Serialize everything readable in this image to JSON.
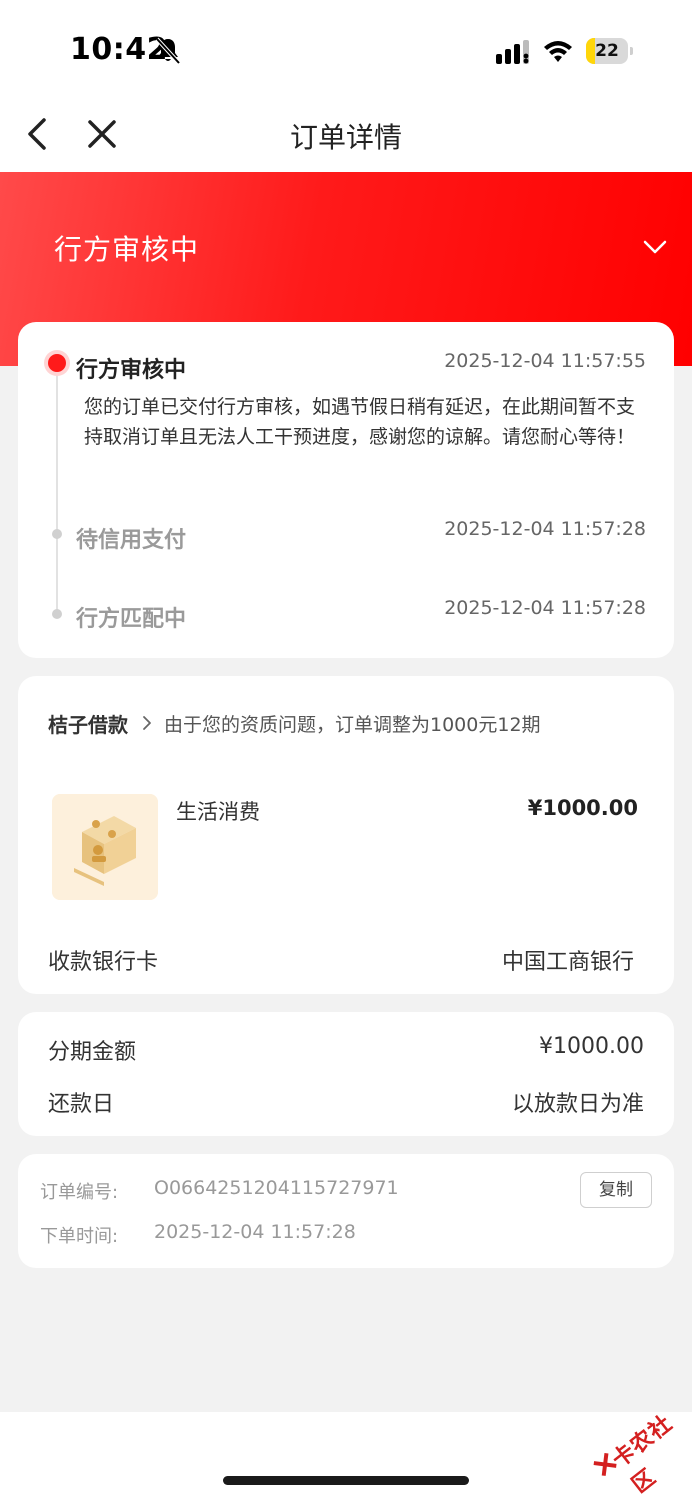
{
  "status_bar": {
    "time": "10:42",
    "battery": "22",
    "icons": [
      "bell-slash-icon",
      "signal-icon",
      "wifi-icon",
      "battery-icon"
    ]
  },
  "nav": {
    "title": "订单详情",
    "back_icon": "chevron-left-icon",
    "close_icon": "close-icon"
  },
  "banner": {
    "status": "行方审核中",
    "expand_icon": "chevron-down-icon",
    "gradient": [
      "#ff4a4a",
      "#ff0000"
    ]
  },
  "timeline": {
    "steps": [
      {
        "title": "行方审核中",
        "time": "2025-12-04 11:57:55",
        "description": "您的订单已交付行方审核，如遇节假日稍有延迟，在此期间暂不支持取消订单且无法人工干预进度，感谢您的谅解。请您耐心等待！",
        "active": true
      },
      {
        "title": "待信用支付",
        "time": "2025-12-04 11:57:28",
        "active": false
      },
      {
        "title": "行方匹配中",
        "time": "2025-12-04 11:57:28",
        "active": false
      }
    ]
  },
  "product": {
    "merchant": "桔子借款",
    "note": "由于您的资质问题，订单调整为1000元12期",
    "item_name": "生活消费",
    "price": "¥1000.00",
    "bank_label": "收款银行卡",
    "bank_value": "中国工商银行"
  },
  "amount": {
    "installment_label": "分期金额",
    "installment_value": "¥1000.00",
    "repay_label": "还款日",
    "repay_value": "以放款日为准"
  },
  "order": {
    "number_label": "订单编号:",
    "number_value": "O0664251204115727971",
    "copy_label": "复制",
    "time_label": "下单时间:",
    "time_value": "2025-12-04 11:57:28"
  },
  "watermark": {
    "text": "卡农社区"
  },
  "colors": {
    "accent": "#ff1a1a",
    "background": "#f2f2f2"
  }
}
